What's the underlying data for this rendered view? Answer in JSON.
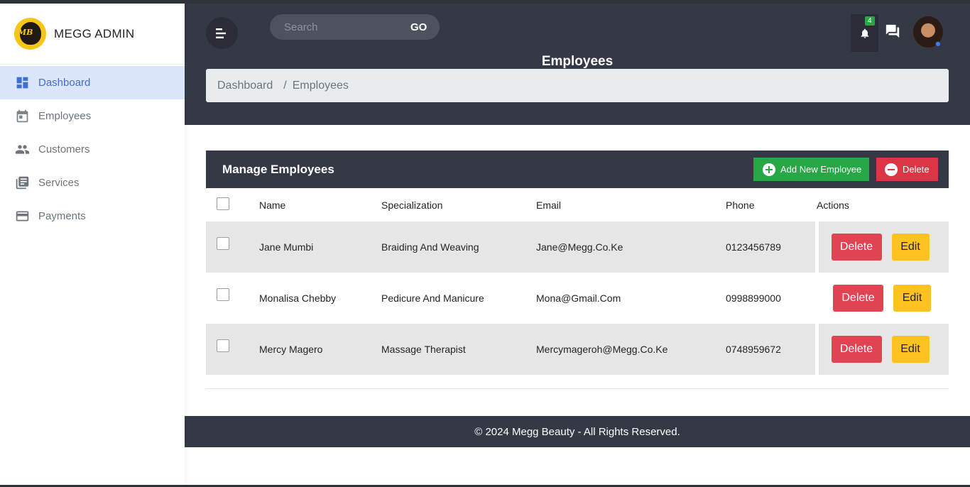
{
  "brand": {
    "name": "MEGG ADMIN",
    "logo_text": "MB"
  },
  "sidebar": {
    "items": [
      {
        "label": "Dashboard",
        "icon": "dashboard-icon",
        "active": true
      },
      {
        "label": "Employees",
        "icon": "calendar-icon",
        "active": false
      },
      {
        "label": "Customers",
        "icon": "people-icon",
        "active": false
      },
      {
        "label": "Services",
        "icon": "library-books-icon",
        "active": false
      },
      {
        "label": "Payments",
        "icon": "credit-card-icon",
        "active": false
      }
    ]
  },
  "topbar": {
    "search_placeholder": "Search",
    "search_button": "GO",
    "notification_count": "4"
  },
  "page": {
    "title": "Employees",
    "breadcrumb": [
      "Dashboard",
      "/",
      "Employees"
    ]
  },
  "card": {
    "title": "Manage Employees",
    "add_button": "Add New Employee",
    "delete_button": "Delete"
  },
  "table": {
    "headers": [
      "Name",
      "Specialization",
      "Email",
      "Phone",
      "Actions"
    ],
    "rows": [
      {
        "name": "Jane Mumbi",
        "specialization": "Braiding And Weaving",
        "email": "Jane@Megg.Co.Ke",
        "phone": "0123456789"
      },
      {
        "name": "Monalisa Chebby",
        "specialization": "Pedicure And Manicure",
        "email": "Mona@Gmail.Com",
        "phone": "0998899000"
      },
      {
        "name": "Mercy Magero",
        "specialization": "Massage Therapist",
        "email": "Mercymageroh@Megg.Co.Ke",
        "phone": "0748959672"
      }
    ],
    "row_delete_label": "Delete",
    "row_edit_label": "Edit"
  },
  "footer": {
    "text": "© 2024 Megg Beauty - All Rights Reserved."
  },
  "colors": {
    "dark": "#353945",
    "active_nav_bg": "#dbe5fb",
    "active_nav_text": "#3f6fcf",
    "success": "#28a745",
    "danger": "#dc3545",
    "warning": "#ffc220"
  }
}
